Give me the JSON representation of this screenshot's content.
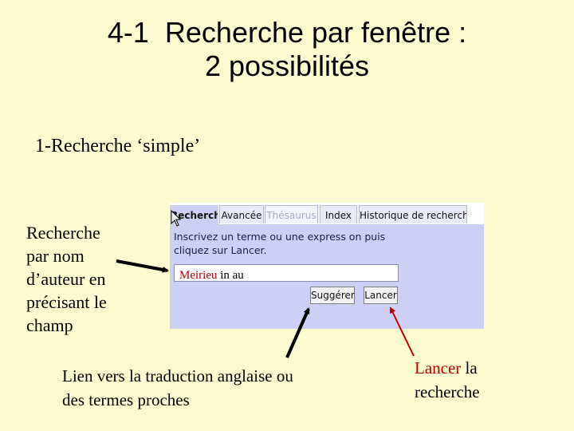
{
  "title": {
    "line1": "4-1  Recherche par fenêtre :",
    "line2": "2 possibilités"
  },
  "subtitle": "1-Recherche ‘simple’",
  "left_note": "Recherche par nom d’auteur en précisant le champ",
  "bottom_note": "Lien vers la traduction anglaise ou des termes proches",
  "right_note": {
    "highlight": "Lancer",
    "rest": " la recherche"
  },
  "widget": {
    "tabs": [
      "Recherche",
      "Avancée",
      "Thésaurus",
      "Index",
      "Historique de recherche"
    ],
    "instruction": "Inscrivez un terme ou une express on puis cliquez sur Lancer.",
    "input_value": {
      "term": "Meirieu",
      "field": " in au"
    },
    "suggest_label": "Suggérer",
    "launch_label": "Lancer"
  },
  "colors": {
    "background": "#fbfbcf",
    "panel": "#cdd0f4",
    "highlight": "#c00000"
  }
}
